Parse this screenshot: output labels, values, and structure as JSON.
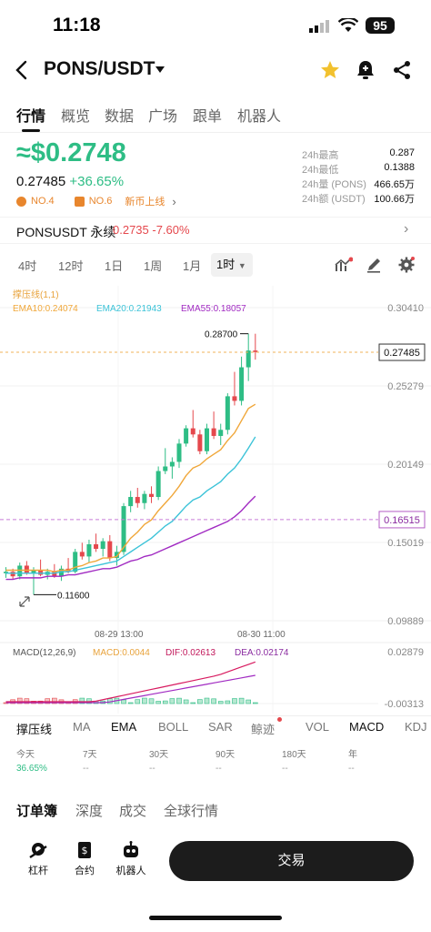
{
  "status": {
    "time": "11:18",
    "battery": "95"
  },
  "header": {
    "pair": "PONS/USDT"
  },
  "tabs": [
    "行情",
    "概览",
    "数据",
    "广场",
    "跟单",
    "机器人"
  ],
  "price": {
    "approx": "≈$0.2748",
    "last": "0.27485",
    "change": "+36.65%",
    "tag1": "NO.4",
    "tag2": "NO.6",
    "tag3": "新币上线"
  },
  "stats": [
    {
      "k": "24h最高",
      "v": "0.287"
    },
    {
      "k": "24h最低",
      "v": "0.1388"
    },
    {
      "k": "24h量 (PONS)",
      "v": "466.65万"
    },
    {
      "k": "24h额 (USDT)",
      "v": "100.66万"
    }
  ],
  "perp": {
    "name": "PONSUSDT 永续",
    "price": "0.2735 -7.60%"
  },
  "timeframes": [
    "4时",
    "12时",
    "1日",
    "1周",
    "1月"
  ],
  "timeframe_active": "1时",
  "chart_data": {
    "type": "candlestick",
    "indicator_label": "撑压线(1,1)",
    "ema_labels": [
      "EMA10:0.24074",
      "EMA20:0.21943",
      "EMA55:0.18057"
    ],
    "y_ticks": [
      "0.30410",
      "0.25279",
      "0.20149",
      "0.15019",
      "0.09889"
    ],
    "last_price_tag": "0.27485",
    "support_tag": "0.16515",
    "high_label": "0.28700",
    "low_label": "0.11600",
    "x_ticks": [
      "08-29 13:00",
      "08-30 11:00"
    ],
    "ylim": [
      0.09889,
      0.3041
    ],
    "candles": [
      [
        0.13,
        0.134,
        0.127,
        0.131
      ],
      [
        0.131,
        0.133,
        0.126,
        0.128
      ],
      [
        0.128,
        0.137,
        0.126,
        0.135
      ],
      [
        0.135,
        0.138,
        0.129,
        0.13
      ],
      [
        0.13,
        0.134,
        0.116,
        0.132
      ],
      [
        0.132,
        0.139,
        0.128,
        0.129
      ],
      [
        0.129,
        0.133,
        0.126,
        0.131
      ],
      [
        0.131,
        0.136,
        0.127,
        0.128
      ],
      [
        0.128,
        0.135,
        0.125,
        0.133
      ],
      [
        0.133,
        0.14,
        0.13,
        0.131
      ],
      [
        0.131,
        0.146,
        0.13,
        0.144
      ],
      [
        0.144,
        0.15,
        0.139,
        0.141
      ],
      [
        0.141,
        0.152,
        0.137,
        0.149
      ],
      [
        0.149,
        0.156,
        0.144,
        0.146
      ],
      [
        0.146,
        0.153,
        0.141,
        0.151
      ],
      [
        0.151,
        0.155,
        0.138,
        0.14
      ],
      [
        0.14,
        0.148,
        0.135,
        0.144
      ],
      [
        0.144,
        0.176,
        0.142,
        0.174
      ],
      [
        0.174,
        0.184,
        0.17,
        0.18
      ],
      [
        0.18,
        0.186,
        0.173,
        0.176
      ],
      [
        0.176,
        0.184,
        0.172,
        0.182
      ],
      [
        0.182,
        0.187,
        0.176,
        0.18
      ],
      [
        0.18,
        0.2,
        0.178,
        0.197
      ],
      [
        0.197,
        0.212,
        0.195,
        0.2
      ],
      [
        0.2,
        0.206,
        0.192,
        0.203
      ],
      [
        0.203,
        0.218,
        0.199,
        0.215
      ],
      [
        0.215,
        0.227,
        0.213,
        0.225
      ],
      [
        0.225,
        0.237,
        0.219,
        0.221
      ],
      [
        0.221,
        0.224,
        0.208,
        0.21
      ],
      [
        0.21,
        0.228,
        0.208,
        0.225
      ],
      [
        0.225,
        0.236,
        0.218,
        0.22
      ],
      [
        0.22,
        0.228,
        0.214,
        0.224
      ],
      [
        0.224,
        0.248,
        0.221,
        0.246
      ],
      [
        0.246,
        0.262,
        0.24,
        0.243
      ],
      [
        0.243,
        0.272,
        0.24,
        0.265
      ],
      [
        0.265,
        0.287,
        0.256,
        0.276
      ],
      [
        0.276,
        0.287,
        0.27,
        0.275
      ]
    ],
    "ema10": [
      0.132,
      0.132,
      0.132,
      0.132,
      0.132,
      0.132,
      0.132,
      0.131,
      0.132,
      0.132,
      0.134,
      0.135,
      0.137,
      0.138,
      0.14,
      0.14,
      0.141,
      0.147,
      0.153,
      0.157,
      0.162,
      0.165,
      0.171,
      0.176,
      0.181,
      0.187,
      0.194,
      0.199,
      0.201,
      0.205,
      0.208,
      0.211,
      0.217,
      0.222,
      0.23,
      0.238,
      0.24074
    ],
    "ema20": [
      0.13,
      0.13,
      0.13,
      0.13,
      0.13,
      0.13,
      0.13,
      0.13,
      0.131,
      0.131,
      0.132,
      0.133,
      0.134,
      0.135,
      0.136,
      0.137,
      0.138,
      0.141,
      0.144,
      0.147,
      0.15,
      0.153,
      0.157,
      0.161,
      0.164,
      0.169,
      0.174,
      0.178,
      0.18,
      0.184,
      0.187,
      0.19,
      0.195,
      0.199,
      0.205,
      0.212,
      0.21943
    ],
    "ema55": [
      0.126,
      0.126,
      0.127,
      0.127,
      0.127,
      0.127,
      0.128,
      0.128,
      0.128,
      0.129,
      0.129,
      0.13,
      0.131,
      0.132,
      0.133,
      0.133,
      0.134,
      0.136,
      0.138,
      0.139,
      0.141,
      0.142,
      0.144,
      0.146,
      0.148,
      0.15,
      0.152,
      0.154,
      0.156,
      0.158,
      0.16,
      0.162,
      0.164,
      0.167,
      0.171,
      0.176,
      0.18057
    ],
    "macd": {
      "label": "MACD(12,26,9)",
      "macd": "MACD:0.0044",
      "dif": "DIF:0.02613",
      "dea": "DEA:0.02174",
      "y_ticks": [
        "0.02879",
        "-0.00313"
      ]
    }
  },
  "indicators": [
    "撑压线",
    "MA",
    "EMA",
    "BOLL",
    "SAR",
    "鲸迹",
    "VOL",
    "MACD",
    "KDJ"
  ],
  "performance": [
    {
      "k": "今天",
      "v": "36.65%"
    },
    {
      "k": "7天",
      "v": "--"
    },
    {
      "k": "30天",
      "v": "--"
    },
    {
      "k": "90天",
      "v": "--"
    },
    {
      "k": "180天",
      "v": "--"
    },
    {
      "k": "年",
      "v": "--"
    }
  ],
  "book_tabs": [
    "订单簿",
    "深度",
    "成交",
    "全球行情"
  ],
  "bottom": {
    "leverage": "杠杆",
    "contract": "合约",
    "bot": "机器人",
    "trade": "交易"
  },
  "colors": {
    "up": "#2ebd85",
    "down": "#e5484d",
    "ema10": "#f0a73a",
    "ema20": "#3cc3d8",
    "ema55": "#a12bc2",
    "accent": "#f2c12e"
  }
}
